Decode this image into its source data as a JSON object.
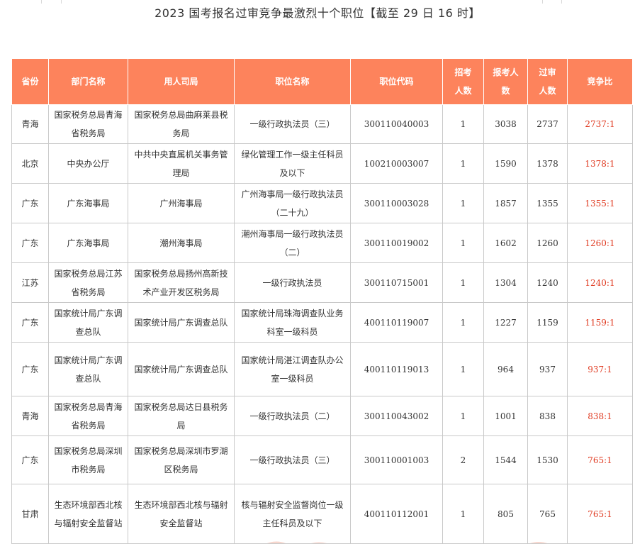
{
  "title": "2023 国考报名过审竞争最激烈十个职位【截至 29 日 16 时】",
  "table": {
    "headers": {
      "province": "省份",
      "department": "部门名称",
      "employer": "用人司局",
      "position": "职位名称",
      "code": "职位代码",
      "recruit_1": "招考",
      "recruit_2": "人数",
      "applicants_1": "报考人",
      "applicants_2": "数",
      "approved_1": "过审",
      "approved_2": "人数",
      "ratio": "竞争比"
    },
    "rows": [
      {
        "province": "青海",
        "department": "国家税务总局青海省税务局",
        "employer": "国家税务总局曲麻莱县税务局",
        "position": "一级行政执法员（三）",
        "code": "300110040003",
        "recruit": "1",
        "applicants": "3038",
        "approved": "2737",
        "ratio": "2737:1"
      },
      {
        "province": "北京",
        "department": "中央办公厅",
        "employer": "中共中央直属机关事务管理局",
        "position": "绿化管理工作一级主任科员及以下",
        "code": "100210003007",
        "recruit": "1",
        "applicants": "1590",
        "approved": "1378",
        "ratio": "1378:1"
      },
      {
        "province": "广东",
        "department": "广东海事局",
        "employer": "广州海事局",
        "position": "广州海事局一级行政执法员（二十九）",
        "code": "300110003028",
        "recruit": "1",
        "applicants": "1857",
        "approved": "1355",
        "ratio": "1355:1"
      },
      {
        "province": "广东",
        "department": "广东海事局",
        "employer": "潮州海事局",
        "position": "潮州海事局一级行政执法员（二）",
        "code": "300110019002",
        "recruit": "1",
        "applicants": "1602",
        "approved": "1260",
        "ratio": "1260:1"
      },
      {
        "province": "江苏",
        "department": "国家税务总局江苏省税务局",
        "employer": "国家税务总局扬州高新技术产业开发区税务局",
        "position": "一级行政执法员",
        "code": "300110715001",
        "recruit": "1",
        "applicants": "1304",
        "approved": "1240",
        "ratio": "1240:1"
      },
      {
        "province": "广东",
        "department": "国家统计局广东调查总队",
        "employer": "国家统计局广东调查总队",
        "position": "国家统计局珠海调查队业务科室一级科员",
        "code": "400110119007",
        "recruit": "1",
        "applicants": "1227",
        "approved": "1159",
        "ratio": "1159:1"
      },
      {
        "province": "广东",
        "department": "国家统计局广东调查总队",
        "employer": "国家统计局广东调查总队",
        "position": "国家统计局湛江调查队办公室一级科员",
        "code": "400110119013",
        "recruit": "1",
        "applicants": "964",
        "approved": "937",
        "ratio": "937:1"
      },
      {
        "province": "青海",
        "department": "国家税务总局青海省税务局",
        "employer": "国家税务总局达日县税务局",
        "position": "一级行政执法员（二）",
        "code": "300110043002",
        "recruit": "1",
        "applicants": "1001",
        "approved": "838",
        "ratio": "838:1"
      },
      {
        "province": "广东",
        "department": "国家税务总局深圳市税务局",
        "employer": "国家税务总局深圳市罗湖区税务局",
        "position": "一级行政执法员（三）",
        "code": "300110001003",
        "recruit": "2",
        "applicants": "1544",
        "approved": "1530",
        "ratio": "765:1"
      },
      {
        "province": "甘肃",
        "department": "生态环境部西北核与辐射安全监督站",
        "employer": "生态环境部西北核与辐射安全监督站",
        "position": "核与辐射安全监督岗位一级主任科员及以下",
        "code": "400110112001",
        "recruit": "1",
        "applicants": "805",
        "approved": "765",
        "ratio": "765:1"
      }
    ]
  },
  "colors": {
    "header_bg": "#fd835c",
    "header_text": "#ffffff",
    "ratio_text": "#e03b22",
    "border": "#c9c9c9"
  }
}
